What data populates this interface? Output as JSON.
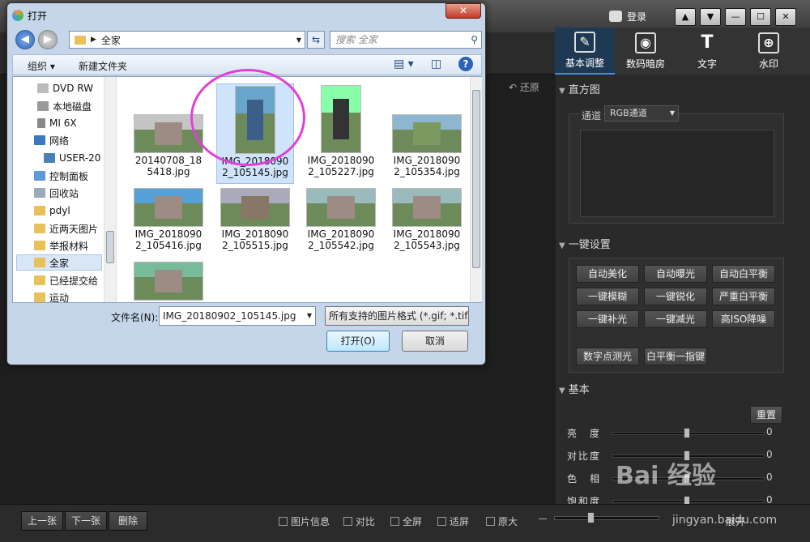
{
  "app": {
    "login_label": "登录",
    "window_buttons": [
      "▲",
      "▼",
      "—",
      "☐",
      "✕"
    ],
    "restore_label": "还原",
    "tool_tabs": [
      {
        "label": "基本调整",
        "icon": "edit-icon"
      },
      {
        "label": "数码暗房",
        "icon": "camera-icon"
      },
      {
        "label": "文字",
        "icon": "text-icon"
      },
      {
        "label": "水印",
        "icon": "watermark-icon"
      }
    ],
    "histogram": {
      "title": "直方图",
      "channel_label": "通道",
      "channel_value": "RGB通道"
    },
    "one_click": {
      "title": "一键设置",
      "buttons": [
        "自动美化",
        "自动曝光",
        "自动白平衡",
        "一键模糊",
        "一键锐化",
        "严重白平衡",
        "一键补光",
        "一键减光",
        "高ISO降噪",
        "数字点测光",
        "白平衡一指键"
      ]
    },
    "basic": {
      "title": "基本",
      "reset_label": "重置",
      "sliders": [
        {
          "label": "亮　度",
          "value": "0"
        },
        {
          "label": "对比度",
          "value": "0"
        },
        {
          "label": "色　相",
          "value": "0"
        },
        {
          "label": "饱和度",
          "value": "0"
        }
      ]
    },
    "bottom": {
      "prev_label": "上一张",
      "next_label": "下一张",
      "delete_label": "删除",
      "info_label": "图片信息",
      "compare_label": "对比",
      "fullscreen_label": "全屏",
      "fit_label": "适屏",
      "original_label": "原大",
      "expand_label": "展开"
    },
    "watermark": {
      "brand": "Bai 经验",
      "url": "jingyan.baidu.com"
    }
  },
  "dialog": {
    "title": "打开",
    "close_label": "✕",
    "address": "全家",
    "search_placeholder": "搜索 全家",
    "organize_label": "组织 ▾",
    "new_folder_label": "新建文件夹",
    "nav_items": [
      {
        "label": "DVD RW",
        "icon": "dvd-drive-icon"
      },
      {
        "label": "本地磁盘",
        "icon": "hard-disk-icon"
      },
      {
        "label": "MI 6X",
        "icon": "phone-icon"
      },
      {
        "label": "网络",
        "icon": "network-icon"
      },
      {
        "label": "USER-20",
        "icon": "computer-icon"
      },
      {
        "label": "控制面板",
        "icon": "control-panel-icon"
      },
      {
        "label": "回收站",
        "icon": "recycle-bin-icon"
      },
      {
        "label": "pdyl",
        "icon": "folder-icon"
      },
      {
        "label": "近两天图片",
        "icon": "folder-icon"
      },
      {
        "label": "举报材料",
        "icon": "folder-icon"
      },
      {
        "label": "全家",
        "icon": "folder-icon"
      },
      {
        "label": "已经提交给",
        "icon": "folder-icon"
      },
      {
        "label": "运动",
        "icon": "folder-icon"
      }
    ],
    "files": [
      {
        "name": "20140708_185418.jpg"
      },
      {
        "name": "IMG_20180902_105145.jpg"
      },
      {
        "name": "IMG_20180902_105227.jpg"
      },
      {
        "name": "IMG_20180902_105354.jpg"
      },
      {
        "name": "IMG_20180902_105416.jpg"
      },
      {
        "name": "IMG_20180902_105515.jpg"
      },
      {
        "name": "IMG_20180902_105542.jpg"
      },
      {
        "name": "IMG_20180902_105543.jpg"
      },
      {
        "name": ""
      }
    ],
    "filename_label": "文件名(N):",
    "filename_value": "IMG_20180902_105145.jpg",
    "filetype_value": "所有支持的图片格式 (*.gif; *.tif",
    "open_label": "打开(O)",
    "cancel_label": "取消"
  }
}
